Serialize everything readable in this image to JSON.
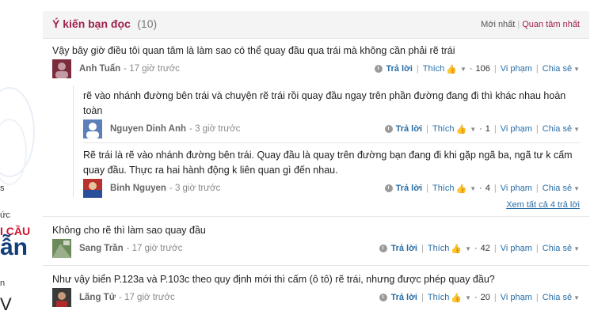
{
  "left_strip": {
    "line1": "s",
    "line2": "ức",
    "line3": "I CẦU",
    "line4": "ẫn",
    "line5": "n",
    "line6": "V"
  },
  "header": {
    "title": "Ý kiến bạn đọc",
    "count": "(10)",
    "sort_newest": "Mới nhất",
    "sort_popular": "Quan tâm nhất"
  },
  "labels": {
    "reply": "Trả lời",
    "like": "Thích",
    "report": "Vi phạm",
    "share": "Chia sẻ",
    "see_all": "Xem tất cả 4 trả lời"
  },
  "comments": [
    {
      "text": "Vậy bây giờ điều tôi quan tâm là làm sao có thể quay đầu qua trái mà không cần phải rẽ trái",
      "author": "Anh Tuấn",
      "time": "- 17 giờ trước",
      "likes": "106",
      "avatar_color": "#7a2c3c",
      "replies": [
        {
          "text": "rẽ vào nhánh đường bên trái và chuyện rẽ trái rồi quay đầu ngay trên phần đường đang đi thì khác nhau hoàn toàn",
          "author": "Nguyen Dinh Anh",
          "time": "- 3 giờ trước",
          "likes": "1",
          "avatar_color": "#5b7fb8"
        },
        {
          "text": "Rẽ trái là rẽ vào nhánh đường bên trái. Quay đầu là quay trên đường bạn đang đi khi gặp ngã ba, ngã tư k cấm quay đầu. Thực ra hai hành động k liên quan gì đến nhau.",
          "author": "Binh Nguyen",
          "time": "- 3 giờ trước",
          "likes": "4",
          "avatar_color": "#b8322e"
        }
      ]
    },
    {
      "text": "Không cho rẽ thì làm sao quay đầu",
      "author": "Sang Trần",
      "time": "- 17 giờ trước",
      "likes": "42",
      "avatar_color": "#6c8a5a"
    },
    {
      "text": "Như vậy biển P.123a và P.103c theo quy định mới thì cấm (ô tô) rẽ trái, nhưng được phép quay đầu?",
      "author": "Lãng Tử",
      "time": "- 17 giờ trước",
      "likes": "20",
      "avatar_color": "#4a4a4a"
    }
  ]
}
